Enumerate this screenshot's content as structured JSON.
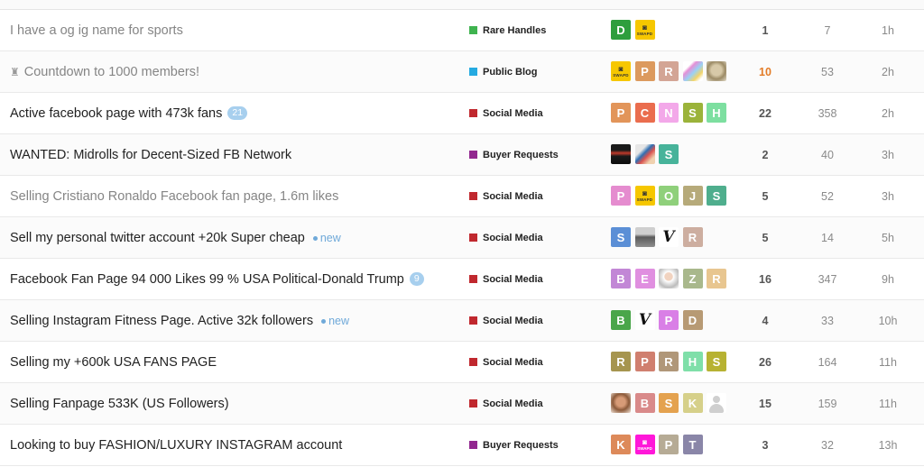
{
  "categories": {
    "rare_handles": {
      "name": "Rare Handles",
      "color": "#3fb34f"
    },
    "public_blog": {
      "name": "Public Blog",
      "color": "#25aae1"
    },
    "social_media": {
      "name": "Social Media",
      "color": "#c0282e"
    },
    "buyer_requests": {
      "name": "Buyer Requests",
      "color": "#92278f"
    }
  },
  "swapd_glyph": "◙",
  "swapd_text": "SWAPD",
  "new_label": "new",
  "topics": [
    {
      "title": "I have a og ig name for sports",
      "visited": true,
      "pinned": false,
      "category": "rare_handles",
      "replies": "1",
      "hot": false,
      "views": "7",
      "activity": "1h",
      "posters": [
        {
          "type": "letter",
          "letter": "D",
          "color": "#2e9e3d"
        },
        {
          "type": "swapd"
        }
      ]
    },
    {
      "title": "Countdown to 1000 members!",
      "visited": true,
      "pinned": true,
      "pin_icon": "♜",
      "category": "public_blog",
      "replies": "10",
      "hot": true,
      "views": "53",
      "activity": "2h",
      "posters": [
        {
          "type": "swapd"
        },
        {
          "type": "letter",
          "letter": "P",
          "color": "#dc9a5e"
        },
        {
          "type": "letter",
          "letter": "R",
          "color": "#d3a595"
        },
        {
          "type": "photo-rainbow"
        },
        {
          "type": "photo-dog"
        }
      ]
    },
    {
      "title": "Active facebook page with 473k fans",
      "visited": false,
      "pinned": false,
      "badge": "21",
      "category": "social_media",
      "replies": "22",
      "hot": false,
      "views": "358",
      "activity": "2h",
      "posters": [
        {
          "type": "letter",
          "letter": "P",
          "color": "#e2955a"
        },
        {
          "type": "letter",
          "letter": "C",
          "color": "#ea6d4e"
        },
        {
          "type": "letter",
          "letter": "N",
          "color": "#f3a8e9"
        },
        {
          "type": "letter",
          "letter": "S",
          "color": "#9bb33a"
        },
        {
          "type": "letter",
          "letter": "H",
          "color": "#7ddfa0"
        }
      ]
    },
    {
      "title": "WANTED: Midrolls for Decent-Sized FB Network",
      "visited": false,
      "pinned": false,
      "category": "buyer_requests",
      "replies": "2",
      "hot": false,
      "views": "40",
      "activity": "3h",
      "posters": [
        {
          "type": "photo-car"
        },
        {
          "type": "photo-people"
        },
        {
          "type": "letter",
          "letter": "S",
          "color": "#47b39a"
        }
      ]
    },
    {
      "title": "Selling Cristiano Ronaldo Facebook fan page, 1.6m likes",
      "visited": true,
      "pinned": false,
      "category": "social_media",
      "replies": "5",
      "hot": false,
      "views": "52",
      "activity": "3h",
      "posters": [
        {
          "type": "letter",
          "letter": "P",
          "color": "#e58ccf"
        },
        {
          "type": "swapd"
        },
        {
          "type": "letter",
          "letter": "O",
          "color": "#8fd07b"
        },
        {
          "type": "letter",
          "letter": "J",
          "color": "#b6aa7a"
        },
        {
          "type": "letter",
          "letter": "S",
          "color": "#4fae8d"
        }
      ]
    },
    {
      "title": "Sell my personal twitter account +20k Super cheap",
      "visited": false,
      "pinned": false,
      "is_new": true,
      "category": "social_media",
      "replies": "5",
      "hot": false,
      "views": "14",
      "activity": "5h",
      "posters": [
        {
          "type": "letter",
          "letter": "S",
          "color": "#5b8fd6"
        },
        {
          "type": "photo-room"
        },
        {
          "type": "photo-vr",
          "glyph": "V"
        },
        {
          "type": "letter",
          "letter": "R",
          "color": "#cdaea0"
        }
      ]
    },
    {
      "title": "Facebook Fan Page 94 000 Likes 99 % USA Political-Donald Trump",
      "visited": false,
      "pinned": false,
      "badge": "9",
      "category": "social_media",
      "replies": "16",
      "hot": false,
      "views": "347",
      "activity": "9h",
      "posters": [
        {
          "type": "letter",
          "letter": "B",
          "color": "#c287d6"
        },
        {
          "type": "letter",
          "letter": "E",
          "color": "#e08fe0"
        },
        {
          "type": "photo-man"
        },
        {
          "type": "letter",
          "letter": "Z",
          "color": "#a9b88c"
        },
        {
          "type": "letter",
          "letter": "R",
          "color": "#e8c690"
        }
      ]
    },
    {
      "title": "Selling Instagram Fitness Page. Active 32k followers",
      "visited": false,
      "pinned": false,
      "is_new": true,
      "category": "social_media",
      "replies": "4",
      "hot": false,
      "views": "33",
      "activity": "10h",
      "posters": [
        {
          "type": "letter",
          "letter": "B",
          "color": "#4aa64a"
        },
        {
          "type": "photo-vr",
          "glyph": "V"
        },
        {
          "type": "letter",
          "letter": "P",
          "color": "#d97fe6"
        },
        {
          "type": "letter",
          "letter": "D",
          "color": "#b79a74"
        }
      ]
    },
    {
      "title": "Selling my +600k USA FANS PAGE",
      "visited": false,
      "pinned": false,
      "category": "social_media",
      "replies": "26",
      "hot": false,
      "views": "164",
      "activity": "11h",
      "posters": [
        {
          "type": "letter",
          "letter": "R",
          "color": "#a6954f"
        },
        {
          "type": "letter",
          "letter": "P",
          "color": "#d07f6f"
        },
        {
          "type": "letter",
          "letter": "R",
          "color": "#b09779"
        },
        {
          "type": "letter",
          "letter": "H",
          "color": "#7fdfa9"
        },
        {
          "type": "letter",
          "letter": "S",
          "color": "#b7b232"
        }
      ]
    },
    {
      "title": "Selling Fanpage 533K (US Followers)",
      "visited": false,
      "pinned": false,
      "category": "social_media",
      "replies": "15",
      "hot": false,
      "views": "159",
      "activity": "11h",
      "posters": [
        {
          "type": "photo-face"
        },
        {
          "type": "letter",
          "letter": "B",
          "color": "#d98a8a"
        },
        {
          "type": "letter",
          "letter": "S",
          "color": "#e4a24f"
        },
        {
          "type": "letter",
          "letter": "K",
          "color": "#d6d08a"
        },
        {
          "type": "default-user"
        }
      ]
    },
    {
      "title": "Looking to buy FASHION/LUXURY INSTAGRAM account",
      "visited": false,
      "pinned": false,
      "category": "buyer_requests",
      "replies": "3",
      "hot": false,
      "views": "32",
      "activity": "13h",
      "posters": [
        {
          "type": "letter",
          "letter": "K",
          "color": "#dd8a5a"
        },
        {
          "type": "swapd-pink"
        },
        {
          "type": "letter",
          "letter": "P",
          "color": "#b6ab95"
        },
        {
          "type": "letter",
          "letter": "T",
          "color": "#8a86a8"
        }
      ]
    }
  ]
}
